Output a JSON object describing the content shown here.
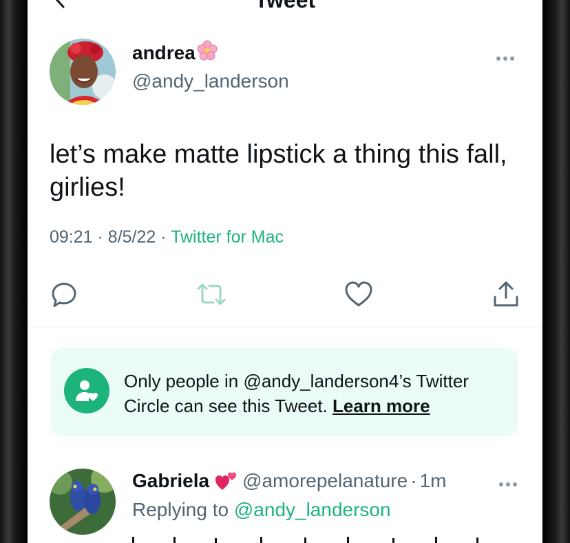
{
  "nav": {
    "title": "Tweet"
  },
  "tweet": {
    "author": {
      "name": "andrea",
      "name_emoji": "cherry-blossom",
      "handle": "@andy_landerson"
    },
    "text": "let’s make matte lipstick a thing this fall, girlies!",
    "time": "09:21",
    "date": "8/5/22",
    "separator": "·",
    "source": "Twitter for Mac",
    "actions": [
      "reply-icon",
      "retweet-icon",
      "like-icon",
      "share-icon"
    ]
  },
  "circle_notice": {
    "text": "Only people in @andy_landerson4’s Twitter Circle can see this Tweet.",
    "link": "Learn more"
  },
  "reply": {
    "name": "Gabriela",
    "name_emoji": "two-hearts",
    "handle": "@amorepelanature",
    "time": "1m",
    "replying_prefix": "Replying to",
    "replying_to": "@andy_landerson"
  },
  "colors": {
    "accent": "#1db47c",
    "secondary_text": "#536471",
    "notice_bg": "#eafcf5",
    "primary_text": "#0f1419"
  }
}
